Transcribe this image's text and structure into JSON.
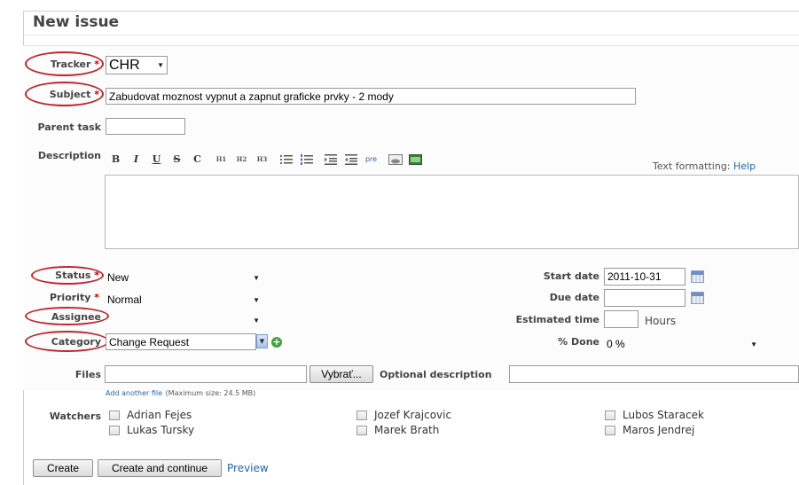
{
  "title": "New issue",
  "fields": {
    "tracker": {
      "label": "Tracker",
      "value": "CHR"
    },
    "subject": {
      "label": "Subject",
      "value": "Zabudovat moznost vypnut a zapnut graficke prvky - 2 mody"
    },
    "parent_task": {
      "label": "Parent task",
      "value": ""
    },
    "description": {
      "label": "Description"
    },
    "status": {
      "label": "Status",
      "value": "New"
    },
    "priority": {
      "label": "Priority",
      "value": "Normal"
    },
    "assignee": {
      "label": "Assignee",
      "value": ""
    },
    "category": {
      "label": "Category",
      "value": "Change Request"
    },
    "start_date": {
      "label": "Start date",
      "value": "2011-10-31"
    },
    "due_date": {
      "label": "Due date",
      "value": ""
    },
    "estimated_time": {
      "label": "Estimated time",
      "value": "",
      "unit": "Hours"
    },
    "done": {
      "label": "% Done",
      "value": "0 %"
    },
    "files": {
      "label": "Files",
      "browse": "Vybrať...",
      "optional_label": "Optional description",
      "add_another": "Add another file",
      "max_size": "(Maximum size: 24.5 MB)"
    }
  },
  "required_mark": "*",
  "toolbar": {
    "buttons": [
      "B",
      "I",
      "U",
      "S",
      "C",
      "H1",
      "H2",
      "H3",
      "ul",
      "ol",
      "indent",
      "outdent",
      "pre",
      "img",
      "link"
    ],
    "text_formatting": "Text formatting:",
    "help": "Help"
  },
  "watchers": {
    "label": "Watchers",
    "names": [
      "Adrian Fejes",
      "Jozef Krajcovic",
      "Lubos Staracek",
      "Lukas Tursky",
      "Marek Brath",
      "Maros Jendrej"
    ]
  },
  "actions": {
    "create": "Create",
    "create_continue": "Create and continue",
    "preview": "Preview"
  },
  "colors": {
    "annotation": "#c0252d",
    "link": "#2266aa",
    "required": "#bb0000"
  }
}
